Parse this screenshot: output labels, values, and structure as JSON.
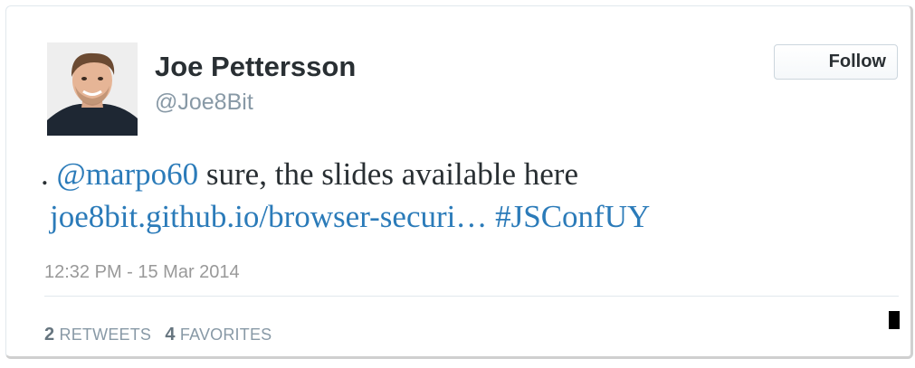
{
  "author": {
    "name": "Joe Pettersson",
    "handle": "@Joe8Bit",
    "avatar_icon": "user-avatar-photo"
  },
  "follow_label": "Follow",
  "tweet": {
    "lead": ". ",
    "mention": "@marpo60",
    "text": " sure, the slides available here",
    "link": "joe8bit.github.io/browser-securi…",
    "hashtag": "#JSConfUY"
  },
  "timestamp": "12:32 PM - 15 Mar 2014",
  "stats": {
    "retweets_count": "2",
    "retweets_label": "RETWEETS",
    "favorites_count": "4",
    "favorites_label": "FAVORITES"
  },
  "colors": {
    "link": "#2b7bb9",
    "text": "#292f33",
    "muted": "#8899a6"
  }
}
